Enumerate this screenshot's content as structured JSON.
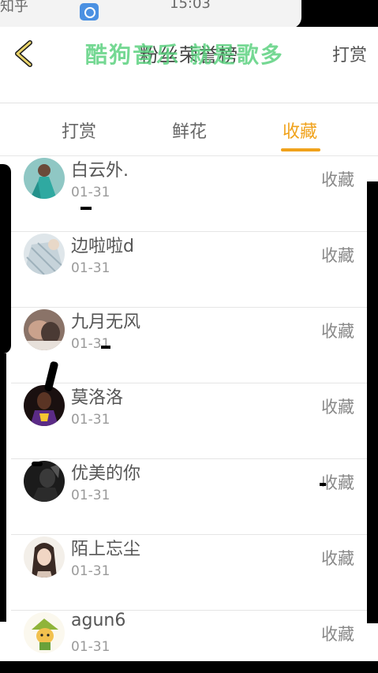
{
  "status_bar": {
    "left_text": "知乎",
    "time": "15:03"
  },
  "header": {
    "title": "粉丝荣誉榜",
    "watermark": "酷狗音乐 就是歌多",
    "right_link": "打赏"
  },
  "tabs": [
    {
      "label": "打赏",
      "active": false
    },
    {
      "label": "鲜花",
      "active": false
    },
    {
      "label": "收藏",
      "active": true
    }
  ],
  "accent_color": "#f0a21b",
  "watermark_color": "#57d07c",
  "rows": [
    {
      "name": "白云外.",
      "date": "01-31",
      "action": "收藏",
      "avatar": "woman-teal-dress-avatar"
    },
    {
      "name": "边啦啦d",
      "date": "01-31",
      "action": "收藏",
      "avatar": "striped-shirt-avatar"
    },
    {
      "name": "九月无风",
      "date": "01-31",
      "action": "收藏",
      "avatar": "couple-photo-avatar"
    },
    {
      "name": "莫洛洛",
      "date": "01-31",
      "action": "收藏",
      "avatar": "basketball-player-avatar"
    },
    {
      "name": "优美的你",
      "date": "01-31",
      "action": "收藏",
      "avatar": "dark-portrait-avatar"
    },
    {
      "name": "陌上忘尘",
      "date": "01-31",
      "action": "收藏",
      "avatar": "anime-girl-avatar"
    },
    {
      "name": "agun6",
      "date": "01-31",
      "action": "收藏",
      "avatar": "cartoon-character-avatar"
    }
  ]
}
